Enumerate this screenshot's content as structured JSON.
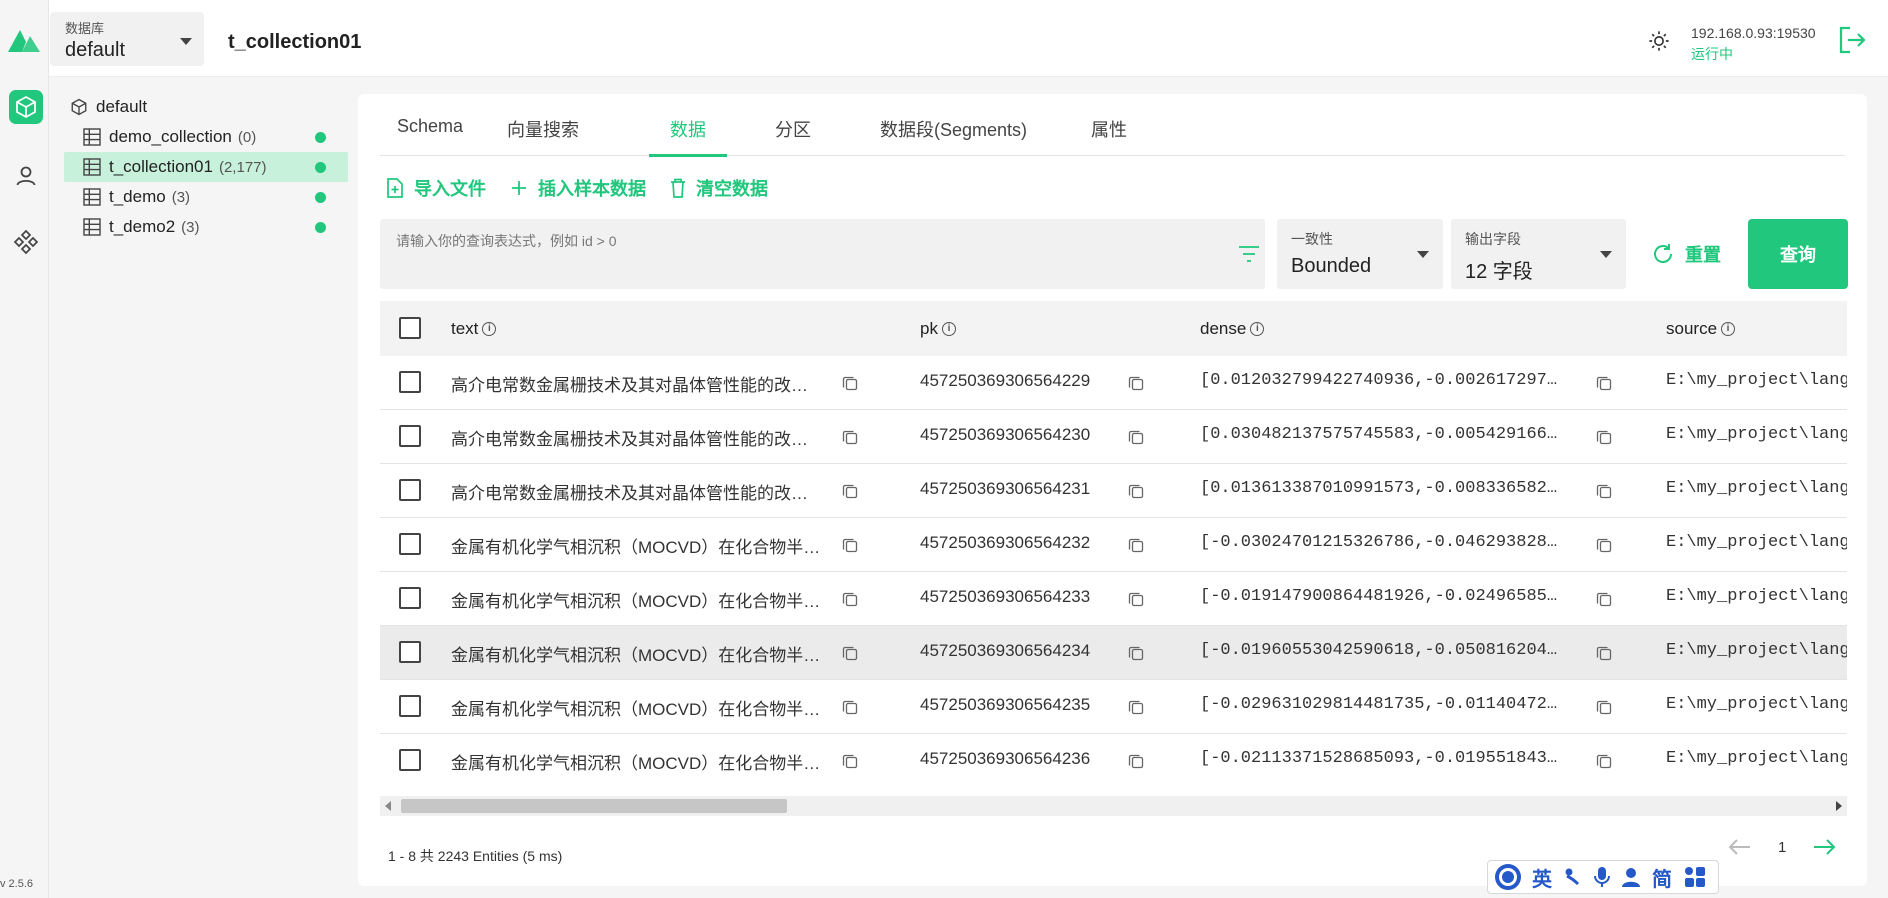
{
  "app": {
    "version": "v 2.5.6"
  },
  "header": {
    "db_label": "数据库",
    "db_value": "default",
    "collection_title": "t_collection01",
    "server_address": "192.168.0.93:19530",
    "server_status": "运行中"
  },
  "tree": {
    "root": "default",
    "items": [
      {
        "name": "demo_collection",
        "count": "(0)"
      },
      {
        "name": "t_collection01",
        "count": "(2,177)"
      },
      {
        "name": "t_demo",
        "count": "(3)"
      },
      {
        "name": "t_demo2",
        "count": "(3)"
      }
    ]
  },
  "tabs": [
    "Schema",
    "向量搜索",
    "数据",
    "分区",
    "数据段(Segments)",
    "属性"
  ],
  "actions": {
    "import": "导入文件",
    "insert_sample": "插入样本数据",
    "clear": "清空数据"
  },
  "query": {
    "placeholder": "请输入你的查询表达式，例如 id > 0",
    "consistency_label": "一致性",
    "consistency_value": "Bounded",
    "output_label": "输出字段",
    "output_value": "12 字段",
    "reset": "重置",
    "submit": "查询"
  },
  "table": {
    "columns": [
      "text",
      "pk",
      "dense",
      "source"
    ],
    "rows": [
      {
        "text": "高介电常数金属栅技术及其对晶体管性能的改…",
        "pk": "457250369306564229",
        "dense": "[0.012032799422740936,-0.002617297…",
        "source": "E:\\my_project\\lang"
      },
      {
        "text": "高介电常数金属栅技术及其对晶体管性能的改…",
        "pk": "457250369306564230",
        "dense": "[0.030482137575745583,-0.005429166…",
        "source": "E:\\my_project\\lang"
      },
      {
        "text": "高介电常数金属栅技术及其对晶体管性能的改…",
        "pk": "457250369306564231",
        "dense": "[0.013613387010991573,-0.008336582…",
        "source": "E:\\my_project\\lang"
      },
      {
        "text": "金属有机化学气相沉积（MOCVD）在化合物半…",
        "pk": "457250369306564232",
        "dense": "[-0.03024701215326786,-0.046293828…",
        "source": "E:\\my_project\\lang"
      },
      {
        "text": "金属有机化学气相沉积（MOCVD）在化合物半…",
        "pk": "457250369306564233",
        "dense": "[-0.019147900864481926,-0.02496585…",
        "source": "E:\\my_project\\lang"
      },
      {
        "text": "金属有机化学气相沉积（MOCVD）在化合物半…",
        "pk": "457250369306564234",
        "dense": "[-0.01960553042590618,-0.050816204…",
        "source": "E:\\my_project\\lang"
      },
      {
        "text": "金属有机化学气相沉积（MOCVD）在化合物半…",
        "pk": "457250369306564235",
        "dense": "[-0.029631029814481735,-0.01140472…",
        "source": "E:\\my_project\\lang"
      },
      {
        "text": "金属有机化学气相沉积（MOCVD）在化合物半…",
        "pk": "457250369306564236",
        "dense": "[-0.02113371528685093,-0.019551843…",
        "source": "E:\\my_project\\lang"
      }
    ]
  },
  "footer": {
    "summary": "1 - 8  共 2243 Entities (5 ms)",
    "page": "1"
  },
  "ime": {
    "lang": "英",
    "mode": "简"
  },
  "colors": {
    "accent": "#20c77c"
  }
}
